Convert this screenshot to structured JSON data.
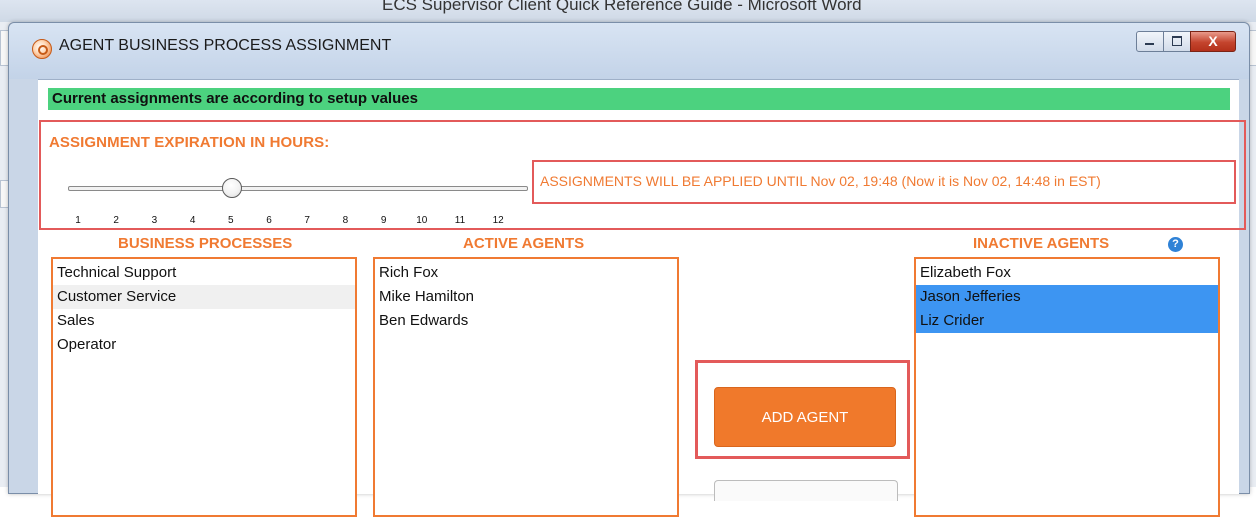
{
  "background_window": {
    "title": "ECS Supervisor Client Quick Reference Guide  -  Microsoft Word"
  },
  "dialog": {
    "title": "AGENT BUSINESS PROCESS ASSIGNMENT",
    "close_label": "X"
  },
  "status": {
    "message": "Current assignments are according to setup values",
    "color": "#4cd27f"
  },
  "expiration": {
    "label": "ASSIGNMENT EXPIRATION IN HOURS:",
    "selected_hours": 5,
    "ticks": [
      "1",
      "2",
      "3",
      "4",
      "5",
      "6",
      "7",
      "8",
      "9",
      "10",
      "11",
      "12"
    ],
    "applied_message": "ASSIGNMENTS WILL BE APPLIED UNTIL Nov 02, 19:48 (Now it is Nov 02, 14:48 in EST)"
  },
  "business_processes": {
    "header": "BUSINESS PROCESSES",
    "items": [
      "Technical Support",
      "Customer Service",
      "Sales",
      "Operator"
    ]
  },
  "active_agents": {
    "header": "ACTIVE AGENTS",
    "items": [
      "Rich Fox",
      "Mike Hamilton",
      "Ben Edwards"
    ]
  },
  "inactive_agents": {
    "header": "INACTIVE AGENTS",
    "help_icon": "?",
    "items": [
      "Elizabeth Fox",
      "Jason Jefferies",
      "Liz Crider"
    ]
  },
  "actions": {
    "add_agent_label": "ADD AGENT"
  },
  "colors": {
    "accent_orange": "#f07a32",
    "highlight_red": "#e35a5a",
    "selection_blue": "#3d95f2"
  }
}
